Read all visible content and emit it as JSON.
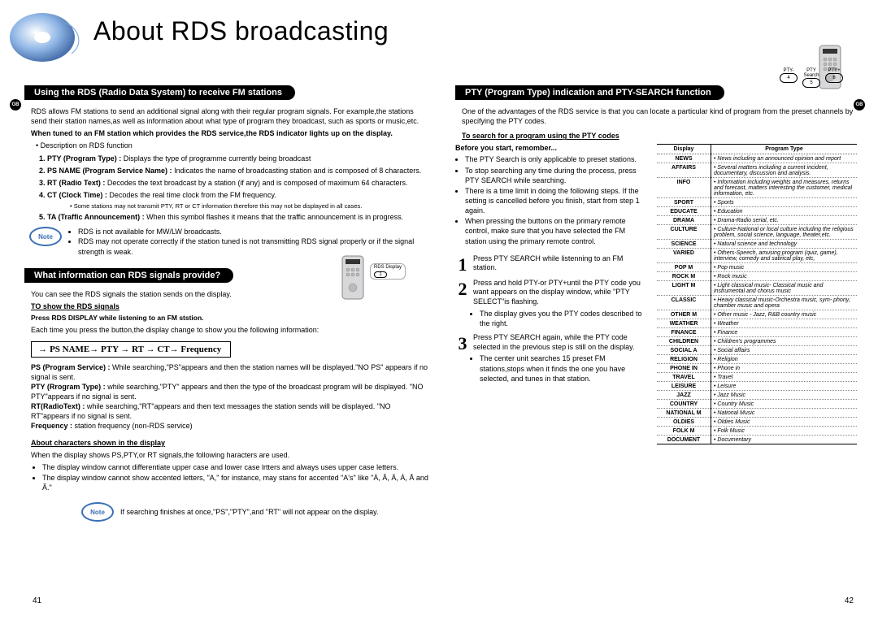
{
  "title": "About RDS broadcasting",
  "gb": "GB",
  "remote_buttons": [
    {
      "top": "PTY-",
      "num": "4"
    },
    {
      "top": "PTY Search",
      "num": "5"
    },
    {
      "top": "PTY+",
      "num": "6"
    }
  ],
  "left": {
    "pill1": "Using the RDS (Radio Data System) to receive FM stations",
    "intro": "RDS allows FM stations to send an additional signal along with their regular program signals. For example,the stations send their station names,as well as information about what  type of program they broadcast, such as sports or music,etc.",
    "tuned_line": "When tuned to an FM station which provides the RDS service,the RDS indicator lights up on the display.",
    "desc_bullet": "Description on RDS function",
    "items": [
      {
        "h": "1. PTY (Program Type) :",
        "t": " Displays the type of programme currently being broadcast"
      },
      {
        "h": "2. PS NAME (Program Service Name) :",
        "t": " Indicates the name of broadcasting station and is composed of 8 characters."
      },
      {
        "h": "3. RT (Radio Text) :",
        "t": " Decodes the text broadcast by a station (if any) and is composed of maximum 64 characters."
      },
      {
        "h": "4. CT (Clock Time) :",
        "t": " Decodes the real time clock from the FM frequency."
      }
    ],
    "small_note": "Some stations may not transmit PTY, RT or CT information therefore this may not be displayed in all cases.",
    "item5": {
      "h": "5. TA (Traffic Announcement) :",
      "t": " When this symbol flashes it means that the traffic announcement is in progress."
    },
    "note1_items": [
      "RDS is not available for MW/LW broadcasts.",
      "RDS may not operate correctly if the station tuned is not transmitting RDS signal properly or if the signal strength is weak."
    ],
    "pill2": "What information can RDS signals provide?",
    "rds_display_label": "RDS Display",
    "rds_display_num": "1",
    "line_under_pill2": "You can see the RDS signals the station sends on the display.",
    "show_heading": "TO show the RDS signals",
    "press_line": "Press RDS DISPLAY while listening to an FM ststion.",
    "each_time": "Each time you press the button,the display change to show you the following information:",
    "seq": "PS NAME → PTY → RT → CT → Frequency",
    "defs": [
      {
        "h": "PS (Program Service) :",
        "t": " While searching,\"PS\"appears and then the station names will be displayed.\"NO PS\" appears if no signal is sent."
      },
      {
        "h": "PTY (Rrogram Type) :",
        "t": " while searching,\"PTY\" appears and then the type of the broadcast program will be displayed. \"NO PTY\"appears if no signal is sent."
      },
      {
        "h": "RT(RadioText) :",
        "t": " while searching,\"RT\"appears and then text messages the station sends will be displayed. \"NO RT\"appears if no signal is sent."
      },
      {
        "h": "Frequency :",
        "t": " station frequency (non-RDS service)"
      }
    ],
    "about_heading": "About characters shown in the display",
    "about_intro": "When the display shows PS,PTY,or RT signals,the following haracters are used.",
    "about_items": [
      "The display window cannot differentiate upper case and lower case lrtters and always uses upper case letters.",
      "The display window  cannot show accented letters, \"A,\" for instance, may stans for accented \"A's\" like \"À, Â, Ä, Á, Å and Ã.\""
    ],
    "note2": "If searching finishes at once,\"PS\",\"PTY\",and \"RT\" will not appear on the display."
  },
  "right": {
    "pill": "PTY (Program Type) indication and PTY-SEARCH function",
    "intro": "One  of the advantages of the RDS service is that you can locate a particular kind of program from the preset channels by specifying the PTY codes.",
    "search_heading": "To search for a program using the PTY codes",
    "before_heading": "Before you start, remomber...",
    "before_items": [
      "The PTY Search is only applicable to preset stations.",
      "To stop searching any time during the process, press PTY SEARCH while searching.",
      "There is a time limit in doing the following steps. If the setting is cancelled before you finish, start from step 1 again.",
      "When pressing the buttons on the primary remote control, make sure that you have selected the FM station using the primary remote control."
    ],
    "steps": [
      {
        "n": "1",
        "t": "Press PTY SEARCH while listenning to an FM station."
      },
      {
        "n": "2",
        "t": "Press and hold PTY-or PTY+until the PTY code you want appears on the display window, while \"PTY SELECT\"is flashing.",
        "sub": "The display gives you the PTY codes described to the right."
      },
      {
        "n": "3",
        "t": "Press PTY SEARCH again, while the PTY code selected in the previous step is still on the display.",
        "sub": "The center unit searches 15 preset FM stations,stops when it finds the one you have selected, and tunes in that station."
      }
    ],
    "table_headers": {
      "c1": "Display",
      "c2": "Program Type"
    },
    "table": [
      {
        "d": "NEWS",
        "t": "News including an announced opinion and report",
        "i": true
      },
      {
        "d": "AFFAIRS",
        "t": "Several matters including a current incident, documentary, discussion and analysis.",
        "i": true
      },
      {
        "d": "INFO",
        "t": "Information including weights and measures, returns and forecast, matters interesting the customer, medical information, etc.",
        "i": true
      },
      {
        "d": "SPORT",
        "t": "Sports",
        "i": true
      },
      {
        "d": "EDUCATE",
        "t": "Education",
        "i": true
      },
      {
        "d": "DRAMA",
        "t": "Drama-Radio serial, etc.",
        "i": true
      },
      {
        "d": "CULTURE",
        "t": "Culture-National or local culture including the religious problem, social science, language, theater,etc.",
        "i": true
      },
      {
        "d": "SCIENCE",
        "t": "Natural science and technology",
        "i": true
      },
      {
        "d": "VARIED",
        "t": "Others-Speech, amusing program (quiz, game), interview, comedy and satirical play, etc,",
        "i": true
      },
      {
        "d": "POP M",
        "t": "Pop music",
        "i": true
      },
      {
        "d": "ROCK M",
        "t": "Rock music",
        "i": true
      },
      {
        "d": "LIGHT M",
        "t": "Light classical music- Classical music and instrumental and chorus music",
        "i": true
      },
      {
        "d": "CLASSIC",
        "t": "Heavy classical  music-Orchestra music, sym- phony, chamber music and opera",
        "i": true
      },
      {
        "d": "OTHER M",
        "t": "Other music - Jazz, R&B country music",
        "i": true
      },
      {
        "d": "WEATHER",
        "t": "Weather",
        "i": true
      },
      {
        "d": "FINANCE",
        "t": "Finance",
        "i": true
      },
      {
        "d": "CHILDREN",
        "t": "Children's programmes",
        "i": true
      },
      {
        "d": "SOCIAL A",
        "t": "Social affairs",
        "i": true
      },
      {
        "d": "RELIGION",
        "t": "Religion",
        "i": true
      },
      {
        "d": "PHONE IN",
        "t": "Phone in",
        "i": true
      },
      {
        "d": "TRAVEL",
        "t": "Travel",
        "i": true
      },
      {
        "d": "LEISURE",
        "t": "Leisure",
        "i": true
      },
      {
        "d": "JAZZ",
        "t": "Jazz Music",
        "i": true
      },
      {
        "d": "COUNTRY",
        "t": "Country Music",
        "i": true
      },
      {
        "d": "NATIONAL M",
        "t": "National Music",
        "i": true
      },
      {
        "d": "OLDIES",
        "t": "Oldies Music",
        "i": true
      },
      {
        "d": "FOLK M",
        "t": "Folk Music",
        "i": true
      },
      {
        "d": "DOCUMENT",
        "t": "Documentary",
        "i": true
      }
    ]
  },
  "page_left": "41",
  "page_right": "42",
  "note_label": "Note"
}
